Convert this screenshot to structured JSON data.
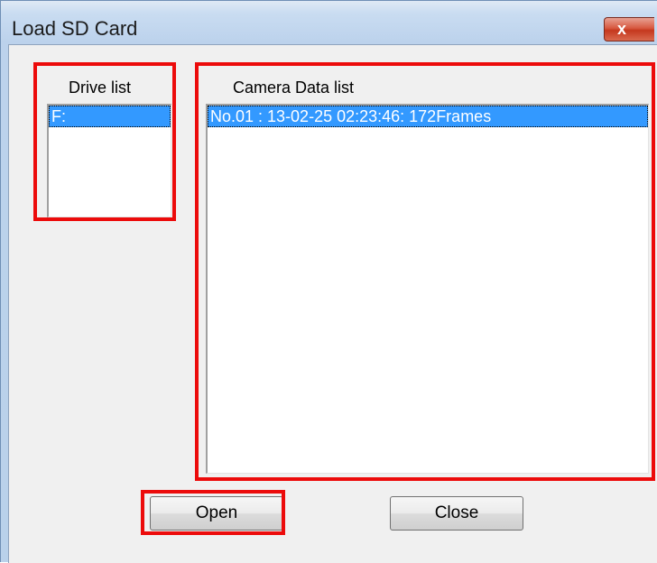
{
  "window": {
    "title": "Load SD Card",
    "close_glyph": "x"
  },
  "drive_list": {
    "label": "Drive list",
    "items": [
      "F:"
    ],
    "selected_index": 0
  },
  "camera_data_list": {
    "label": "Camera Data list",
    "items": [
      "No.01 : 13-02-25  02:23:46:  172Frames"
    ],
    "selected_index": 0
  },
  "buttons": {
    "open_label": "Open",
    "close_label": "Close"
  },
  "annotations": {
    "highlight_color": "#ec0b0b"
  },
  "colors": {
    "selection": "#3399ff",
    "dialog_bg": "#f0f0f0"
  }
}
